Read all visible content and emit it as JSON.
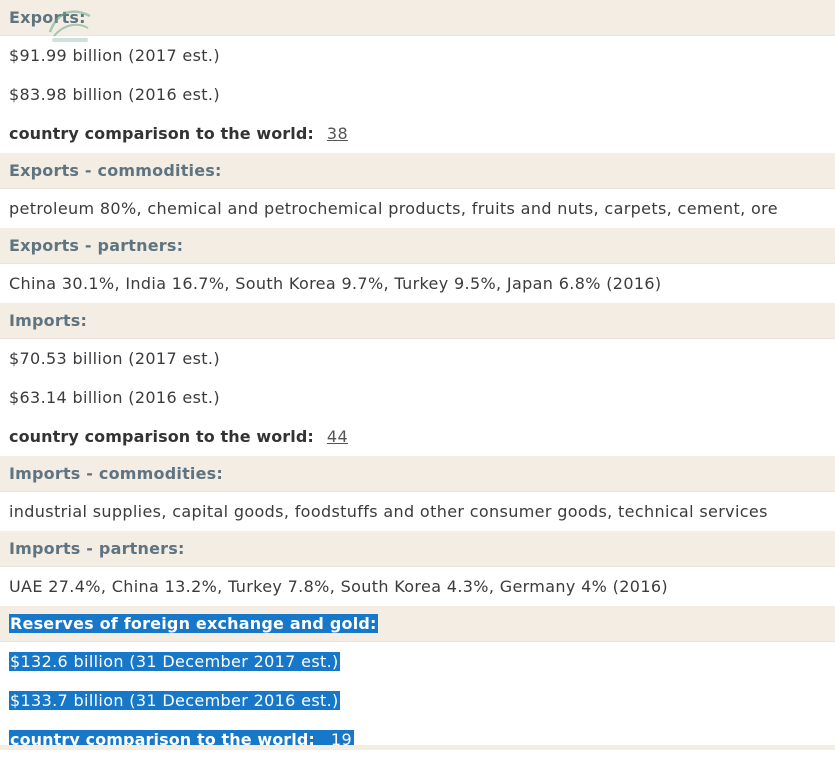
{
  "exports": {
    "header": "Exports:",
    "line1": "$91.99 billion (2017 est.)",
    "line2": "$83.98 billion (2016 est.)",
    "comparison_label": "country comparison to the world:",
    "rank": "38"
  },
  "exports_commodities": {
    "header": "Exports - commodities:",
    "text": "petroleum 80%, chemical and petrochemical products, fruits and nuts, carpets, cement, ore"
  },
  "exports_partners": {
    "header": "Exports - partners:",
    "text": "China 30.1%, India 16.7%, South Korea 9.7%, Turkey 9.5%, Japan 6.8% (2016)"
  },
  "imports": {
    "header": "Imports:",
    "line1": "$70.53 billion (2017 est.)",
    "line2": "$63.14 billion (2016 est.)",
    "comparison_label": "country comparison to the world:",
    "rank": "44"
  },
  "imports_commodities": {
    "header": "Imports - commodities:",
    "text": "industrial supplies, capital goods, foodstuffs and other consumer goods, technical services"
  },
  "imports_partners": {
    "header": "Imports - partners:",
    "text": "UAE 27.4%, China 13.2%, Turkey 7.8%, South Korea 4.3%, Germany 4% (2016)"
  },
  "reserves": {
    "header": "Reserves of foreign exchange and gold:",
    "line1": "$132.6 billion (31 December 2017 est.)",
    "line2": "$133.7 billion (31 December 2016 est.)",
    "comparison_label": "country comparison to the world:",
    "rank": "19"
  },
  "colors": {
    "header_bg": "#f3ede4",
    "header_text": "#5e7480",
    "highlight": "#1777c8"
  }
}
